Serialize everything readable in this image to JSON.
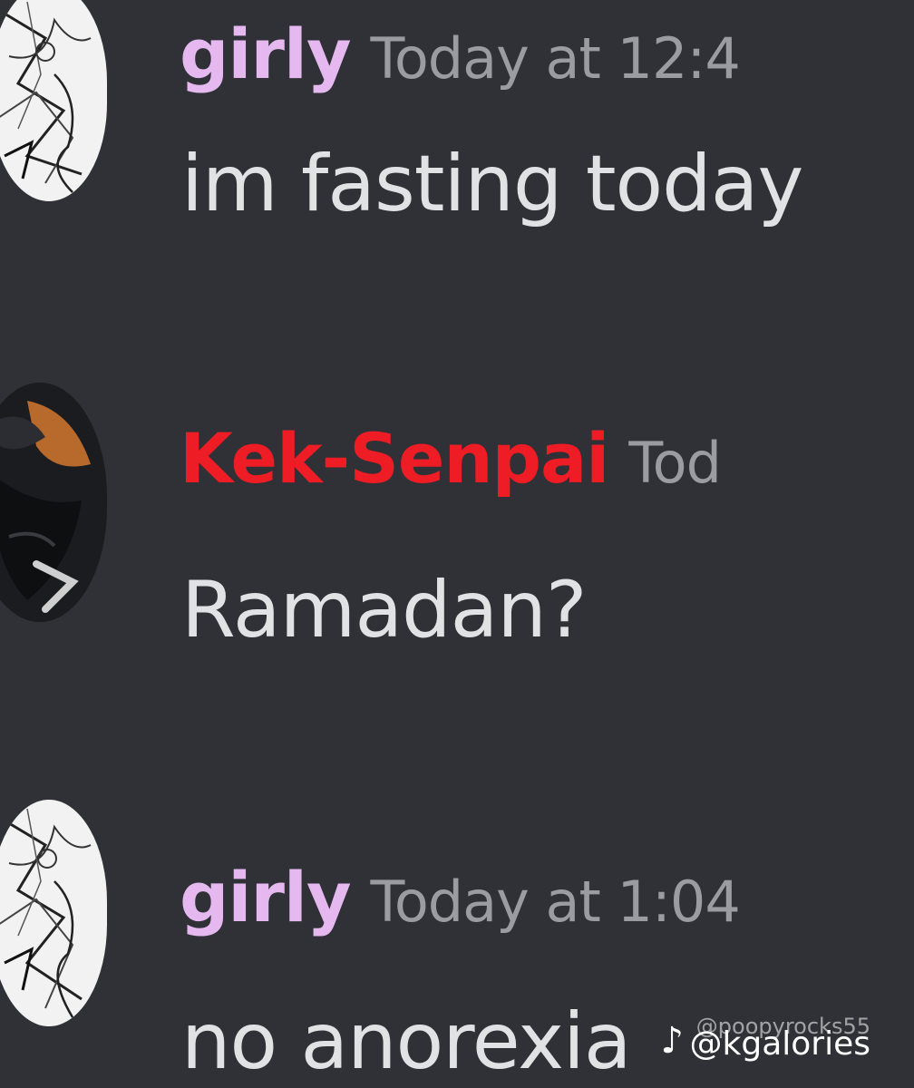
{
  "messages": [
    {
      "author": "girly",
      "timestamp": "Today at 12:4",
      "text": "im fasting today",
      "name_color": "#e6b8f0"
    },
    {
      "author": "Kek-Senpai",
      "timestamp": "Tod",
      "text": "Ramadan?",
      "name_color": "#ee1c24"
    },
    {
      "author": "girly",
      "timestamp": "Today at 1:04",
      "text": "no anorexia",
      "name_color": "#e6b8f0"
    }
  ],
  "watermark": {
    "icon": "tiktok-icon",
    "line1": "@poopyrocks55",
    "line2": "@kgalories"
  },
  "colors": {
    "background": "#2f3136",
    "message_text": "#e1e2e4",
    "timestamp": "#9a9ca2"
  }
}
